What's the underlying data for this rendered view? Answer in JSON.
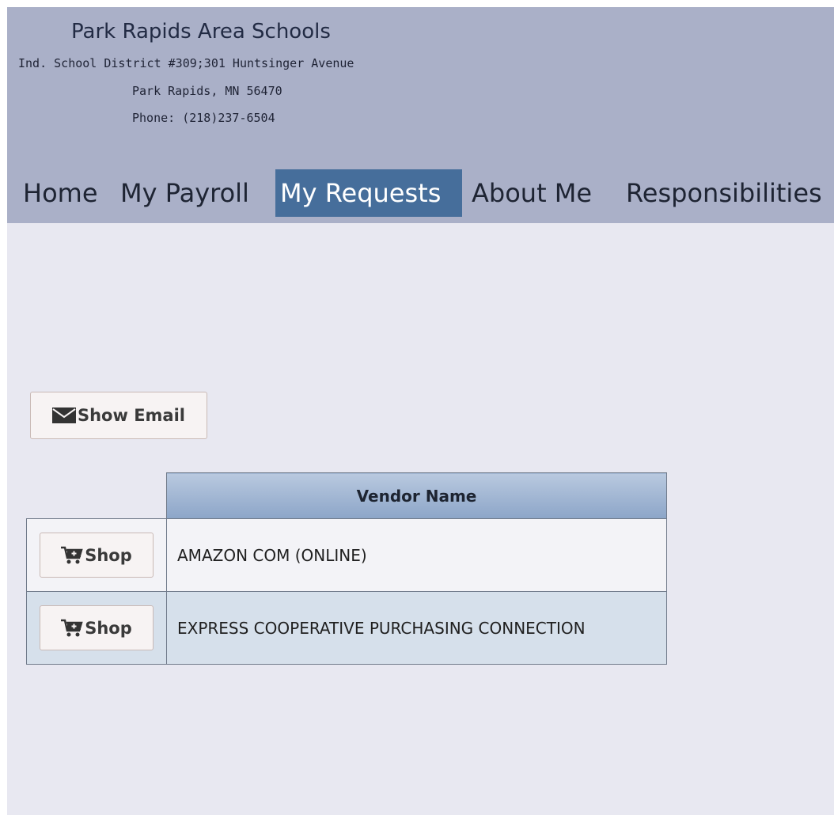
{
  "header": {
    "org_name": "Park Rapids Area Schools",
    "address_line1": "Ind. School District #309;301 Huntsinger Avenue",
    "address_line2": "Park Rapids, MN 56470",
    "phone": "Phone: (218)237-6504"
  },
  "nav": {
    "items": [
      {
        "label": "Home"
      },
      {
        "label": "My Payroll"
      },
      {
        "label": "My Requests",
        "active": true
      },
      {
        "label": "About Me"
      },
      {
        "label": "Responsibilities"
      }
    ]
  },
  "email_button": {
    "label": "Show Email",
    "icon": "envelope-icon"
  },
  "vendors_table": {
    "columns": [
      "",
      "Vendor Name"
    ],
    "rows": [
      {
        "action_label": "Shop",
        "icon": "shopping-cart-icon",
        "vendor": "AMAZON COM (ONLINE)"
      },
      {
        "action_label": "Shop",
        "icon": "shopping-cart-icon",
        "vendor": "EXPRESS COOPERATIVE PURCHASING CONNECTION"
      }
    ]
  },
  "colors": {
    "header_bg": "#aab0c8",
    "page_bg": "#e8e8f1",
    "nav_active_bg": "#466e9b",
    "row_alt_bg": "#d6e0eb"
  }
}
